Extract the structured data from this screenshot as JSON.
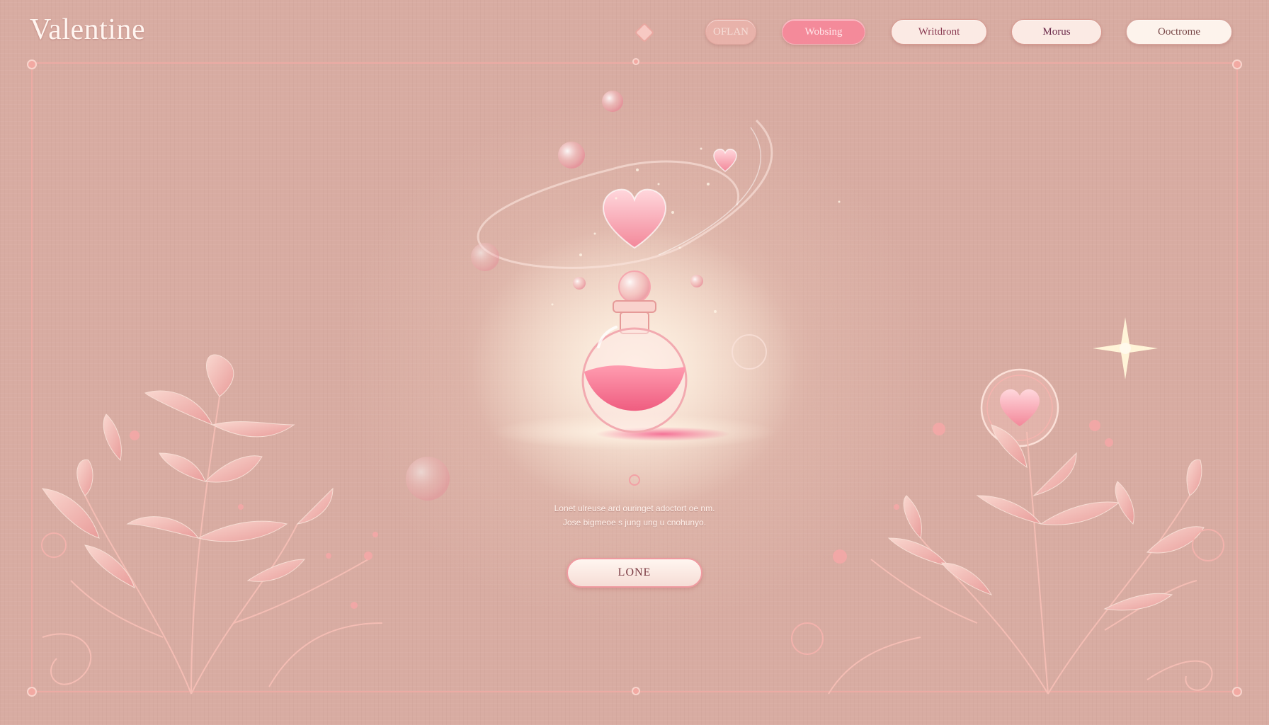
{
  "header": {
    "brand": "Valentine",
    "nav": [
      {
        "label": "OFLAN"
      },
      {
        "label": "Wobsing"
      },
      {
        "label": "Writdront"
      },
      {
        "label": "Morus"
      },
      {
        "label": "Ooctrome"
      }
    ]
  },
  "main": {
    "description_line1": "Lonet ulreuse ard ouringet adoctort oe nm.",
    "description_line2": "Jose bigmeoe s jung ung u cnohunyo.",
    "cta_label": "LONE"
  },
  "colors": {
    "background": "#d8aca2",
    "accent_pink": "#f48a9a",
    "potion": "#f27a92",
    "frame_line": "#f0aaa5"
  },
  "icons": [
    "heart-icon",
    "potion-bottle-icon",
    "sparkle-icon",
    "bubble-icon",
    "leaf-branch-icon"
  ]
}
